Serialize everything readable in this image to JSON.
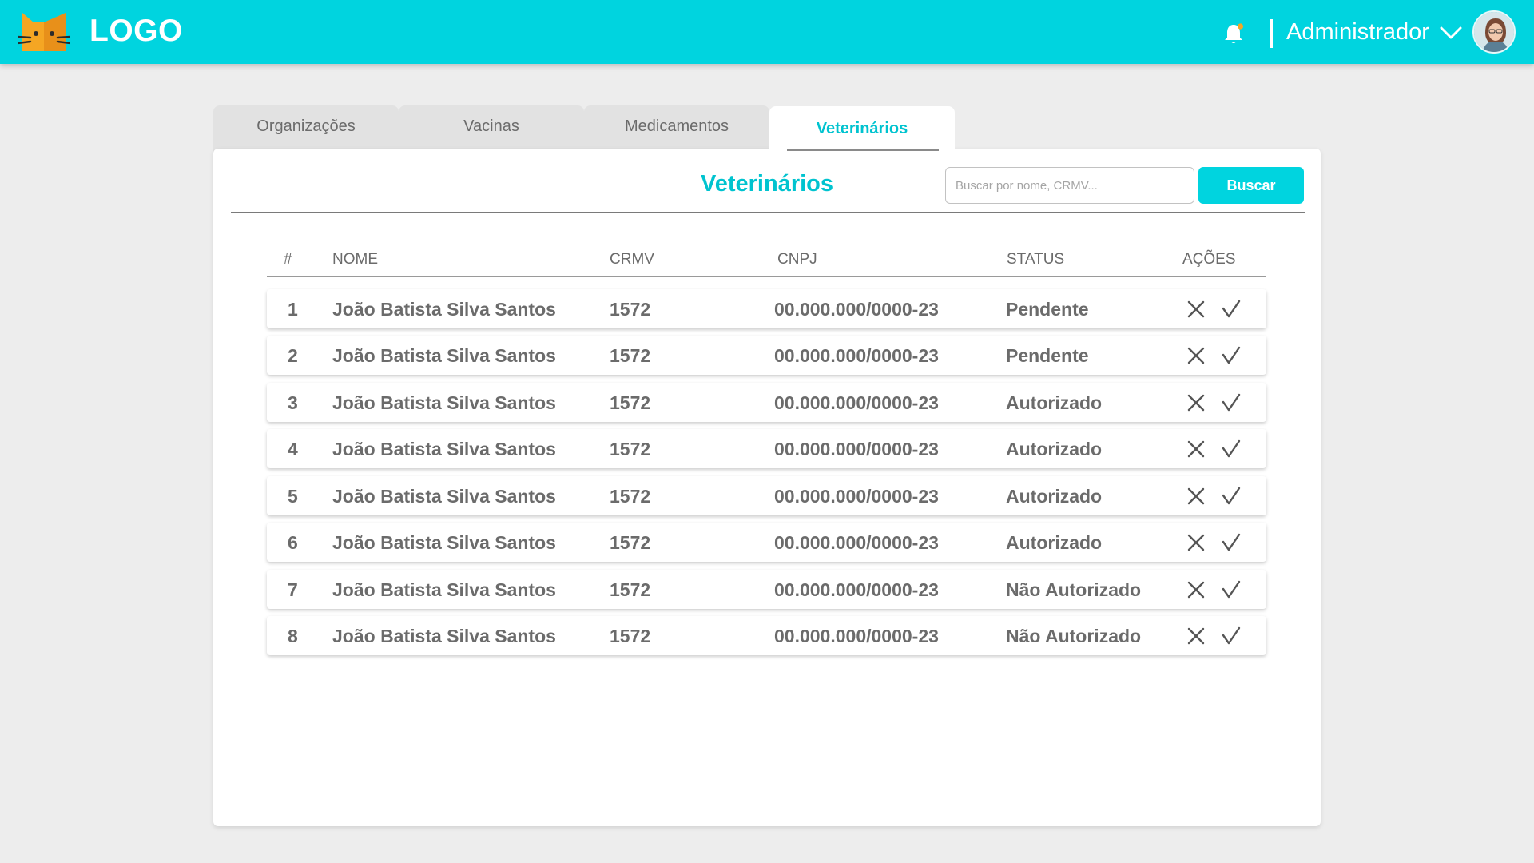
{
  "header": {
    "logo_text": "LOGO",
    "user_name": "Administrador",
    "accent_color": "#00d4df",
    "icons": [
      "cat-logo-icon",
      "bell-icon",
      "chevron-down-icon",
      "avatar"
    ]
  },
  "tabs": [
    {
      "label": "Organizações",
      "active": false
    },
    {
      "label": "Vacinas",
      "active": false
    },
    {
      "label": "Medicamentos",
      "active": false
    },
    {
      "label": "Veterinários",
      "active": true
    }
  ],
  "main": {
    "title": "Veterinários",
    "search": {
      "placeholder": "Buscar por nome, CRMV...",
      "value": ""
    },
    "search_button": "Buscar"
  },
  "table": {
    "headers": {
      "num": "#",
      "name": "NOME",
      "crmv": "CRMV",
      "cnpj": "CNPJ",
      "status": "STATUS",
      "actions": "AÇÕES"
    },
    "rows": [
      {
        "num": "1",
        "name": "João Batista Silva Santos",
        "crmv": "1572",
        "cnpj": "00.000.000/0000-23",
        "status": "Pendente"
      },
      {
        "num": "2",
        "name": "João Batista Silva Santos",
        "crmv": "1572",
        "cnpj": "00.000.000/0000-23",
        "status": "Pendente"
      },
      {
        "num": "3",
        "name": "João Batista Silva Santos",
        "crmv": "1572",
        "cnpj": "00.000.000/0000-23",
        "status": "Autorizado"
      },
      {
        "num": "4",
        "name": "João Batista Silva Santos",
        "crmv": "1572",
        "cnpj": "00.000.000/0000-23",
        "status": "Autorizado"
      },
      {
        "num": "5",
        "name": "João Batista Silva Santos",
        "crmv": "1572",
        "cnpj": "00.000.000/0000-23",
        "status": "Autorizado"
      },
      {
        "num": "6",
        "name": "João Batista Silva Santos",
        "crmv": "1572",
        "cnpj": "00.000.000/0000-23",
        "status": "Autorizado"
      },
      {
        "num": "7",
        "name": "João Batista Silva Santos",
        "crmv": "1572",
        "cnpj": "00.000.000/0000-23",
        "status": "Não Autorizado"
      },
      {
        "num": "8",
        "name": "João Batista Silva Santos",
        "crmv": "1572",
        "cnpj": "00.000.000/0000-23",
        "status": "Não Autorizado"
      }
    ],
    "row_actions": [
      "reject-icon",
      "approve-icon"
    ]
  }
}
